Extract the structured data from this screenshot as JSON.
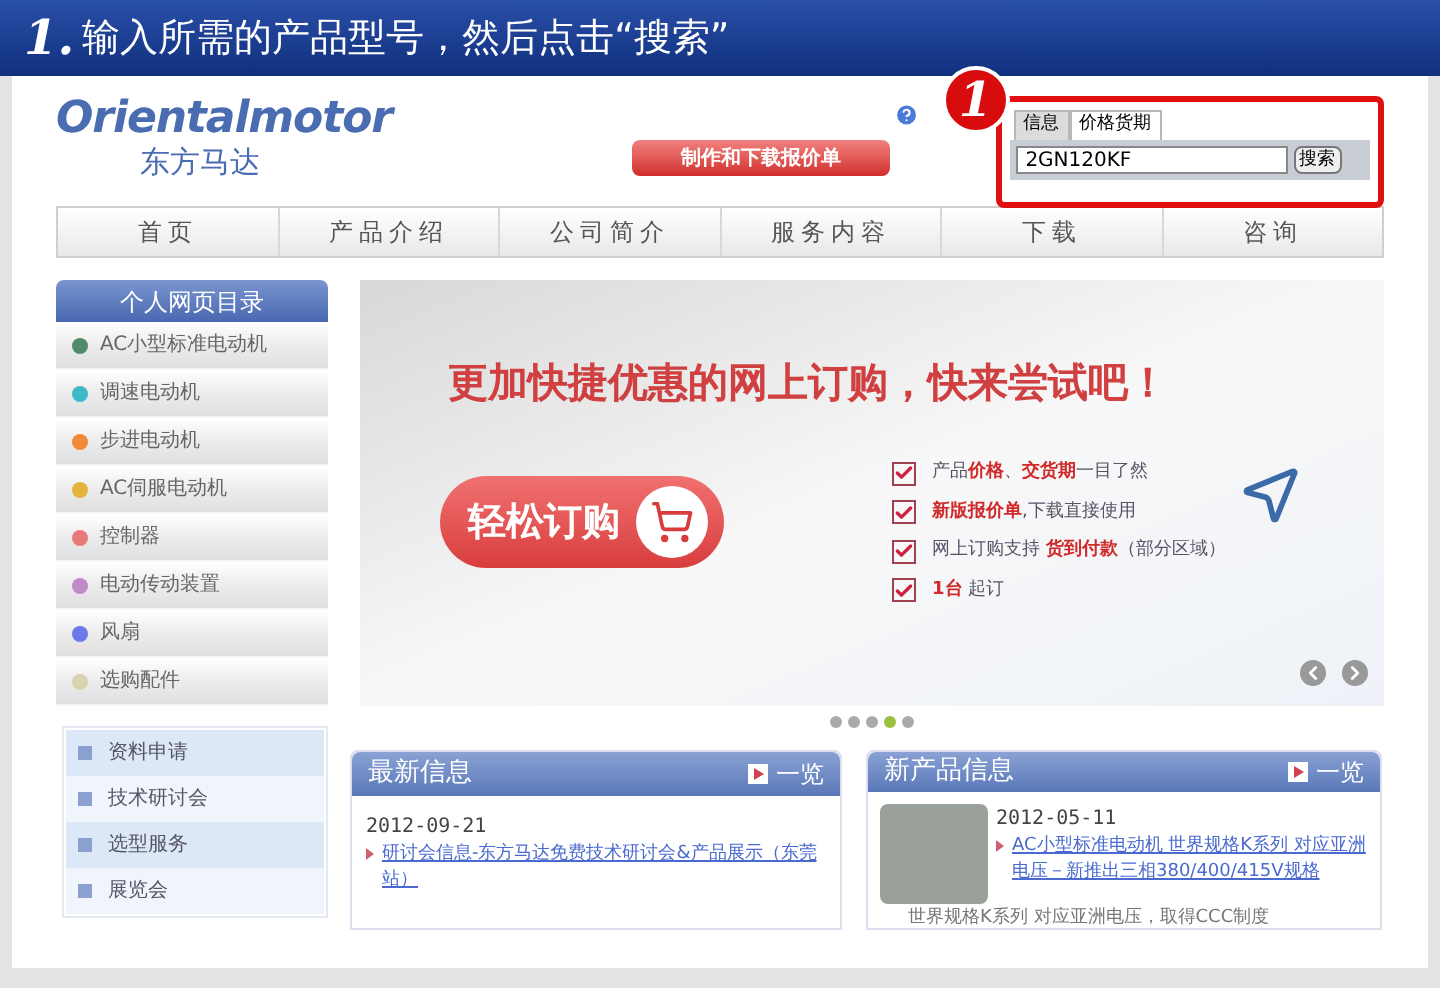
{
  "instruction": {
    "step": "1.",
    "text": "输入所需的产品型号，然后点击“搜索”"
  },
  "logo": {
    "brand": "Orientalmotor",
    "chinese": "东方马达"
  },
  "quote_button": "制作和下载报价单",
  "callout": "1",
  "search": {
    "tabs": [
      {
        "label": "信息",
        "selected": false
      },
      {
        "label": "价格货期",
        "selected": true
      }
    ],
    "value": "2GN120KF",
    "button": "搜索"
  },
  "nav": [
    "首页",
    "产品介绍",
    "公司简介",
    "服务内容",
    "下载",
    "咨询"
  ],
  "sidebar": {
    "title": "个人网页目录",
    "items": [
      {
        "label": "AC小型标准电动机",
        "color": "#4f8a6a"
      },
      {
        "label": "调速电动机",
        "color": "#3fb8c8"
      },
      {
        "label": "步进电动机",
        "color": "#ef8a3a"
      },
      {
        "label": "AC伺服电动机",
        "color": "#e6b43a"
      },
      {
        "label": "控制器",
        "color": "#e87a7a"
      },
      {
        "label": "电动传动装置",
        "color": "#c08ac8"
      },
      {
        "label": "风扇",
        "color": "#6a7ae8"
      },
      {
        "label": "选购配件",
        "color": "#d8d4b0"
      }
    ]
  },
  "links": [
    "资料申请",
    "技术研讨会",
    "选型服务",
    "展览会"
  ],
  "banner": {
    "headline": "更加快捷优惠的网上订购，快来尝试吧！",
    "button": "轻松订购",
    "features": [
      "产品**价格**、**交货期**一目了然",
      "**新版报价单**,下载直接使用",
      "网上订购支持 **货到付款**（部分区域）",
      "**1台** 起订"
    ]
  },
  "slides": [
    {
      "selected": false
    },
    {
      "selected": false
    },
    {
      "selected": false
    },
    {
      "selected": true
    },
    {
      "selected": false
    }
  ],
  "news": {
    "title": "最新信息",
    "more": "一览",
    "date": "2012-09-21",
    "link": "研讨会信息-东方马达免费技术研讨会&产品展示（东莞站）"
  },
  "products": {
    "title": "新产品信息",
    "more": "一览",
    "date": "2012-05-11",
    "link": "AC小型标准电动机 世界规格K系列 对应亚洲电压－新推出三相380/400/415V规格",
    "snippet": "世界规格K系列 对应亚洲电压，取得CCC制度"
  }
}
